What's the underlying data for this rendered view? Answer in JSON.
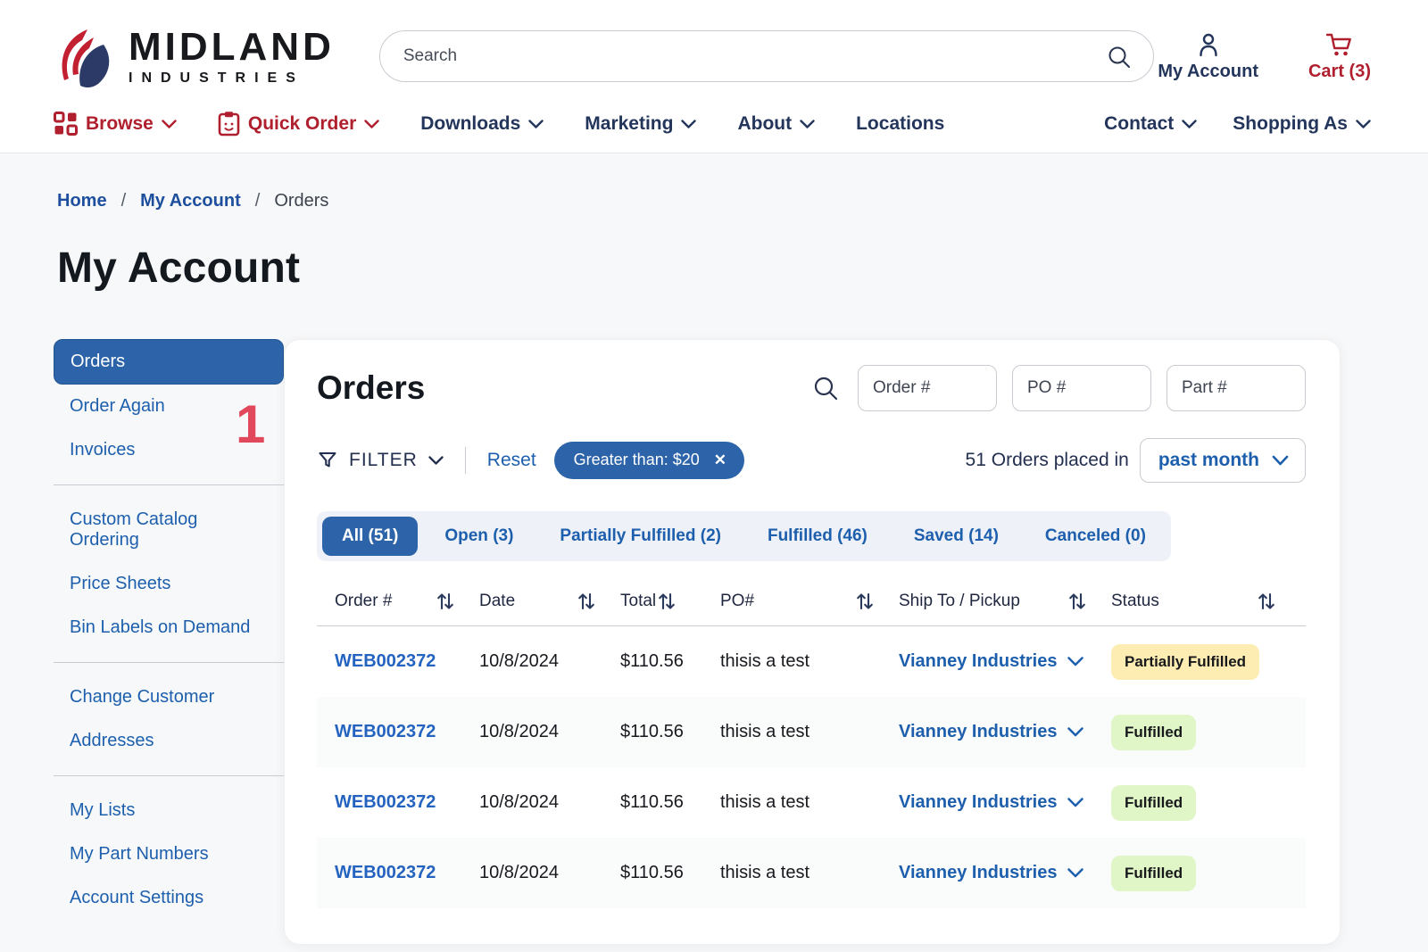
{
  "brand": {
    "name_top": "MIDLAND",
    "name_bottom": "INDUSTRIES"
  },
  "header": {
    "search_placeholder": "Search",
    "account_label": "My Account",
    "cart_label": "Cart (3)"
  },
  "nav": {
    "left": [
      {
        "label": "Browse",
        "style": "red",
        "icon": "grid-icon",
        "chevron": true
      },
      {
        "label": "Quick Order",
        "style": "red",
        "icon": "clipboard-icon",
        "chevron": true
      },
      {
        "label": "Downloads",
        "style": "navy",
        "icon": null,
        "chevron": true
      },
      {
        "label": "Marketing",
        "style": "navy",
        "icon": null,
        "chevron": true
      },
      {
        "label": "About",
        "style": "navy",
        "icon": null,
        "chevron": true
      },
      {
        "label": "Locations",
        "style": "navy",
        "icon": null,
        "chevron": false
      }
    ],
    "right": [
      {
        "label": "Contact",
        "style": "navy",
        "icon": null,
        "chevron": true
      },
      {
        "label": "Shopping As",
        "style": "navy",
        "icon": null,
        "chevron": true
      }
    ]
  },
  "breadcrumb": {
    "separator": "/",
    "items": [
      {
        "label": "Home",
        "link": true
      },
      {
        "label": "My Account",
        "link": true
      },
      {
        "label": "Orders",
        "link": false
      }
    ]
  },
  "page_title": "My Account",
  "sidebar": {
    "annotation": "1",
    "groups": [
      {
        "items": [
          {
            "label": "Orders",
            "active": true
          },
          {
            "label": "Order Again",
            "active": false
          },
          {
            "label": "Invoices",
            "active": false
          }
        ]
      },
      {
        "items": [
          {
            "label": "Custom Catalog Ordering",
            "active": false
          },
          {
            "label": "Price Sheets",
            "active": false
          },
          {
            "label": "Bin Labels on Demand",
            "active": false
          }
        ]
      },
      {
        "items": [
          {
            "label": "Change Customer",
            "active": false
          },
          {
            "label": "Addresses",
            "active": false
          }
        ]
      },
      {
        "items": [
          {
            "label": "My Lists",
            "active": false
          },
          {
            "label": "My Part Numbers",
            "active": false
          },
          {
            "label": "Account Settings",
            "active": false
          }
        ]
      }
    ]
  },
  "orders_panel": {
    "title": "Orders",
    "search_fields": [
      {
        "placeholder": "Order #"
      },
      {
        "placeholder": "PO #"
      },
      {
        "placeholder": "Part #"
      }
    ],
    "filter_label": "FILTER",
    "reset_label": "Reset",
    "active_filter_chip": "Greater than: $20",
    "orders_count_text": "51 Orders placed in",
    "period_selected": "past month",
    "tabs": [
      {
        "label": "All (51)",
        "active": true
      },
      {
        "label": "Open (3)",
        "active": false
      },
      {
        "label": "Partially Fulfilled (2)",
        "active": false
      },
      {
        "label": "Fulfilled (46)",
        "active": false
      },
      {
        "label": "Saved (14)",
        "active": false
      },
      {
        "label": "Canceled (0)",
        "active": false
      }
    ],
    "table": {
      "columns": [
        "Order #",
        "Date",
        "Total",
        "PO#",
        "Ship To / Pickup",
        "Status"
      ],
      "rows": [
        {
          "order_number": "WEB002372",
          "date": "10/8/2024",
          "total": "$110.56",
          "po": "thisis a test",
          "ship_to": "Vianney Industries",
          "status": "Partially Fulfilled",
          "status_type": "partial"
        },
        {
          "order_number": "WEB002372",
          "date": "10/8/2024",
          "total": "$110.56",
          "po": "thisis a test",
          "ship_to": "Vianney Industries",
          "status": "Fulfilled",
          "status_type": "fulfilled"
        },
        {
          "order_number": "WEB002372",
          "date": "10/8/2024",
          "total": "$110.56",
          "po": "thisis a test",
          "ship_to": "Vianney Industries",
          "status": "Fulfilled",
          "status_type": "fulfilled"
        },
        {
          "order_number": "WEB002372",
          "date": "10/8/2024",
          "total": "$110.56",
          "po": "thisis a test",
          "ship_to": "Vianney Industries",
          "status": "Fulfilled",
          "status_type": "fulfilled"
        }
      ]
    }
  },
  "colors": {
    "brand_red": "#b01f2e",
    "navy": "#24355c",
    "link_blue": "#1d5fad",
    "accent_blue": "#2d64a9",
    "badge_yellow": "#fdedb3",
    "badge_green": "#e1f6c6",
    "annotation_red": "#e2485b"
  }
}
